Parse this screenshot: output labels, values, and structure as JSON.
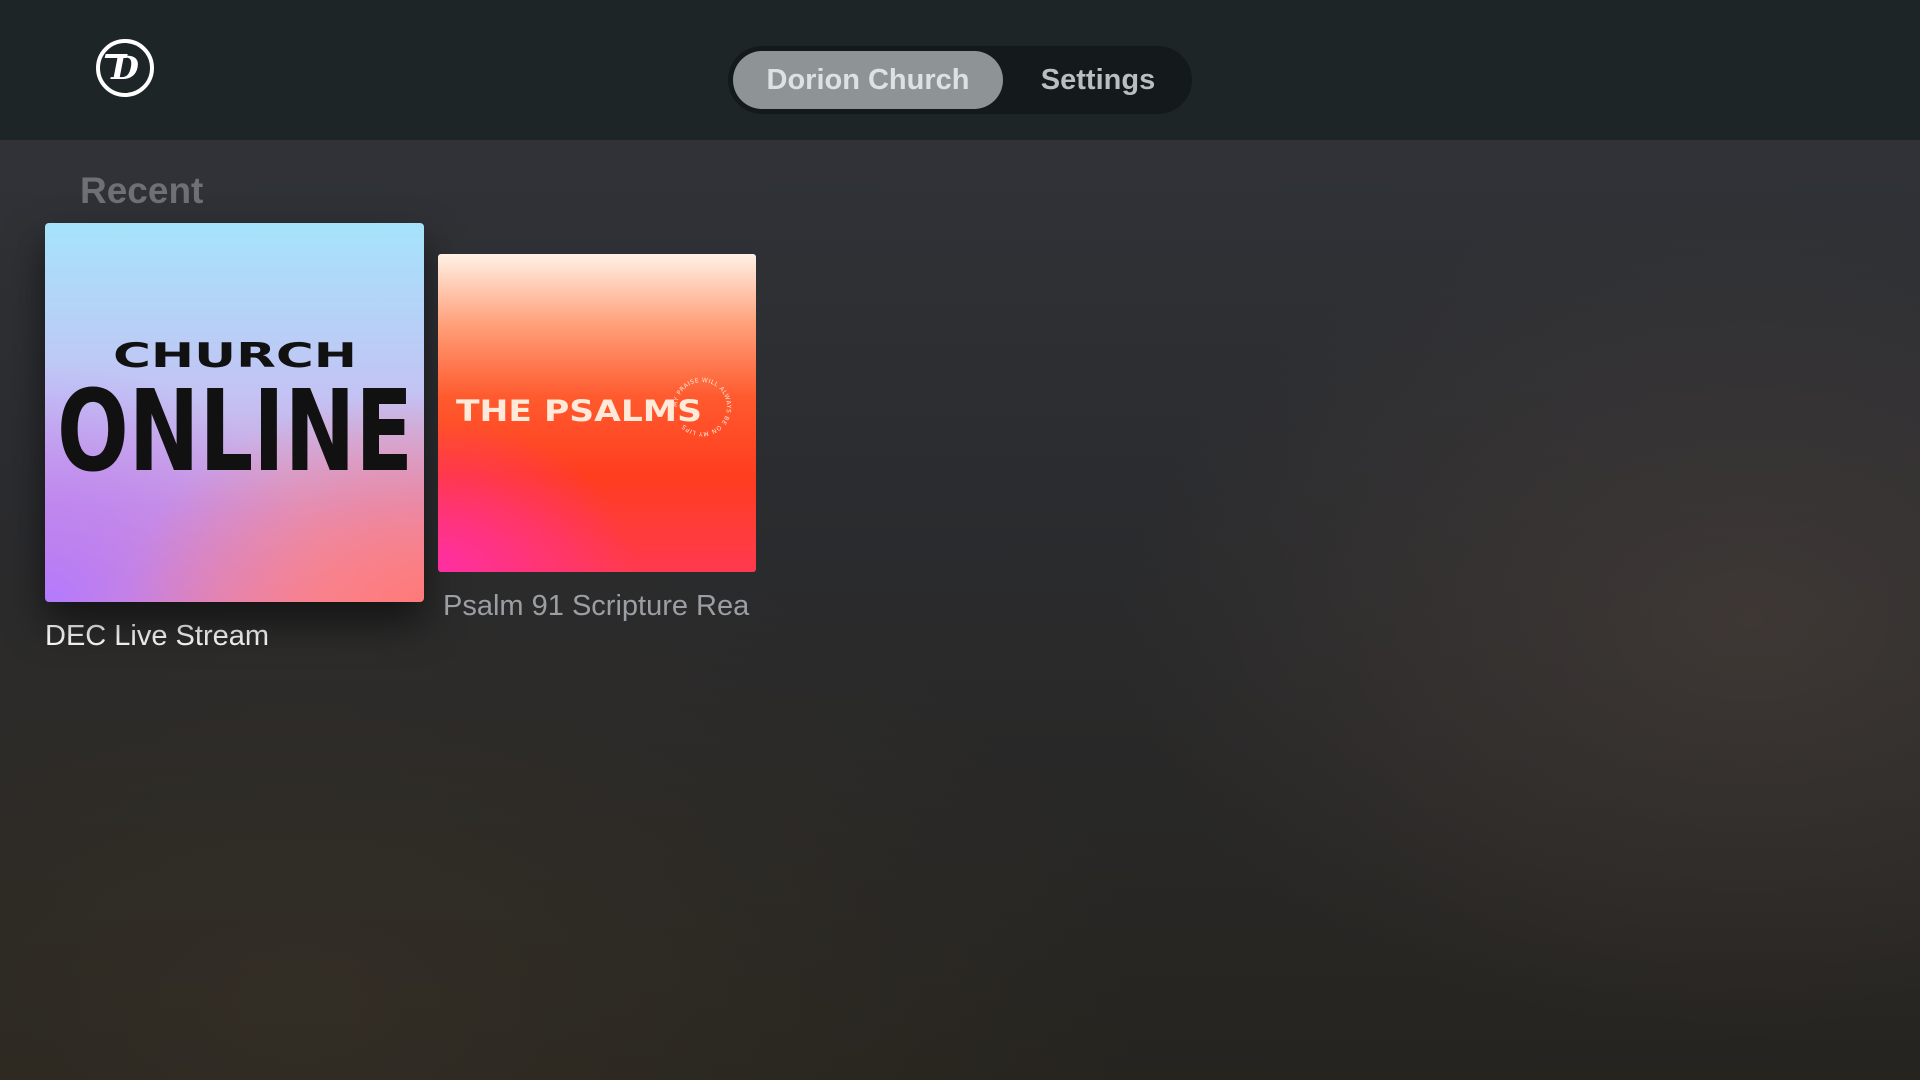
{
  "app": {
    "logo_icon": "dorion-d-logo-icon"
  },
  "tabs": [
    {
      "label": "Dorion Church",
      "active": true
    },
    {
      "label": "Settings",
      "active": false
    }
  ],
  "section": {
    "title": "Recent"
  },
  "items": [
    {
      "label": "DEC Live Stream",
      "artwork": {
        "line1": "CHURCH",
        "line2": "ONLINE"
      }
    },
    {
      "label": "Psalm 91 Scripture Rea",
      "artwork": {
        "title": "THE PSALMS",
        "circle_text": "MY PRAISE WILL ALWAYS BE ON MY LIPS"
      }
    }
  ],
  "colors": {
    "topbar": "#1d2527",
    "active_tab": "#8e9395"
  }
}
